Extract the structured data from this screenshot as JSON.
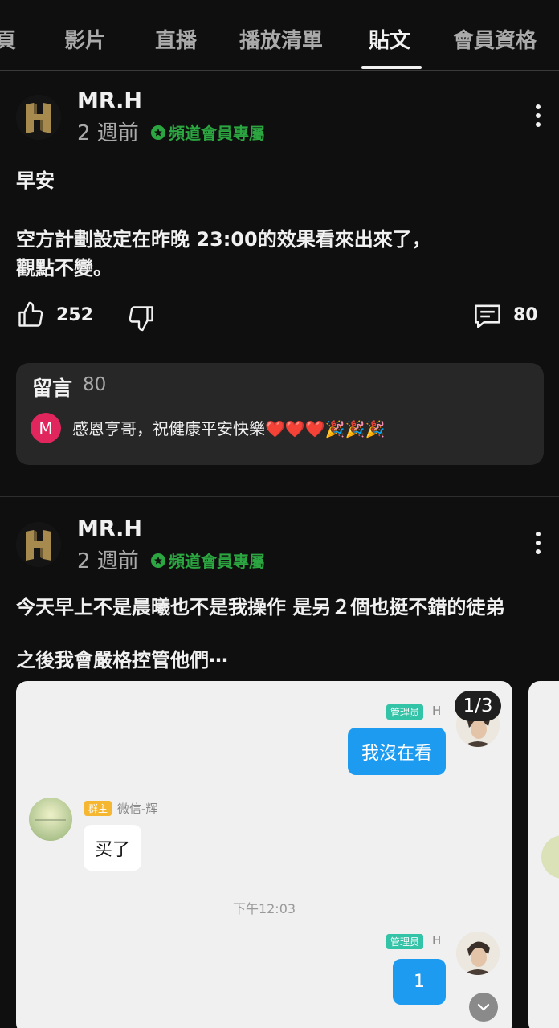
{
  "tabs": [
    {
      "label": "頁"
    },
    {
      "label": "影片"
    },
    {
      "label": "直播"
    },
    {
      "label": "播放清單"
    },
    {
      "label": "貼文",
      "active": true
    },
    {
      "label": "會員資格"
    }
  ],
  "posts": [
    {
      "author": "MR.H",
      "time": "2 週前",
      "badge": "頻道會員專屬",
      "text_lines": [
        "早安",
        "空方計劃設定在昨晚 23:00的效果看來出來了，",
        "觀點不變。"
      ],
      "likes": "252",
      "comments": "80",
      "comments_box": {
        "title": "留言",
        "count": "80",
        "first_comment": {
          "avatar_letter": "M",
          "text": "感恩亨哥，祝健康平安快樂❤️❤️❤️🎉🎉🎉"
        }
      }
    },
    {
      "author": "MR.H",
      "time": "2 週前",
      "badge": "頻道會員專屬",
      "text_lines": [
        "今天早上不是晨曦也不是我操作 是另２個也挺不錯的徒弟",
        "之後我會嚴格控管他們⋯"
      ],
      "image_counter": "1/3",
      "chat": {
        "msg1": {
          "role": "管理员",
          "name": "H",
          "text": "我沒在看"
        },
        "msg2": {
          "role": "群主",
          "name": "微信-辉",
          "text": "买了"
        },
        "timestamp": "下午12:03",
        "msg3": {
          "role": "管理员",
          "name": "H",
          "text": "1"
        }
      }
    }
  ],
  "colors": {
    "background": "#0f0f0f",
    "member_badge": "#2ba640",
    "chat_bubble": "#1d9bf0",
    "admin_tag": "#33c3a6",
    "owner_tag": "#f5b731"
  }
}
